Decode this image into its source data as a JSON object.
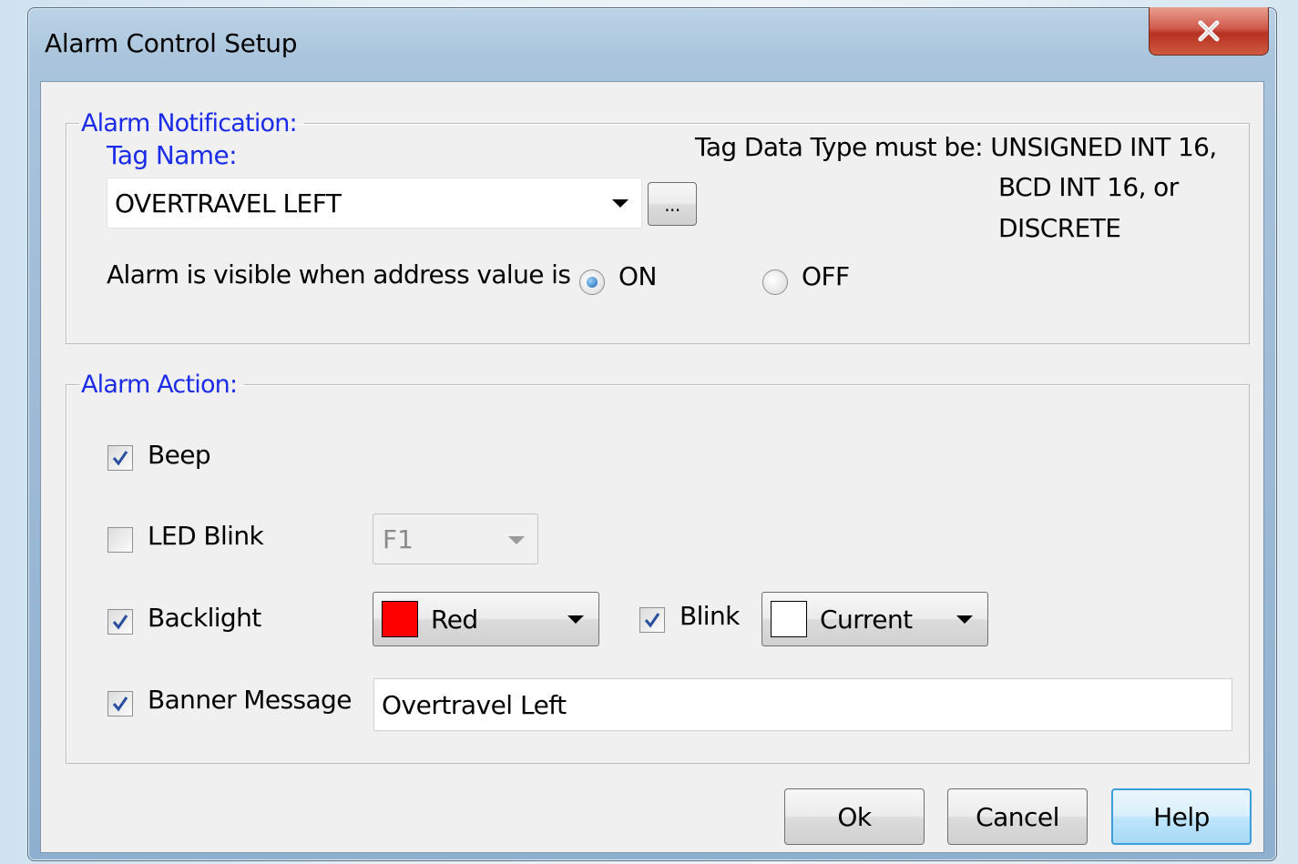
{
  "window": {
    "title": "Alarm Control Setup"
  },
  "notification": {
    "legend": "Alarm Notification:",
    "tag_name_label": "Tag Name:",
    "tag_name_value": "OVERTRAVEL LEFT",
    "browse_label": "...",
    "type_note_line1": "Tag Data Type must be: UNSIGNED INT 16,",
    "type_note_line2": "BCD INT 16, or",
    "type_note_line3": "DISCRETE",
    "visible_label": "Alarm is visible when address value is",
    "radio_on": {
      "label": "ON",
      "selected": true
    },
    "radio_off": {
      "label": "OFF",
      "selected": false
    }
  },
  "action": {
    "legend": "Alarm Action:",
    "beep": {
      "label": "Beep",
      "checked": true
    },
    "led_blink": {
      "label": "LED Blink",
      "checked": false,
      "key": "F1"
    },
    "backlight": {
      "label": "Backlight",
      "checked": true,
      "color_name": "Red",
      "color_hex": "#ff0000"
    },
    "blink": {
      "label": "Blink",
      "checked": true,
      "color_name": "Current",
      "color_hex": "#ffffff"
    },
    "banner": {
      "label": "Banner Message",
      "checked": true,
      "value": "Overtravel Left"
    }
  },
  "buttons": {
    "ok": "Ok",
    "cancel": "Cancel",
    "help": "Help"
  }
}
